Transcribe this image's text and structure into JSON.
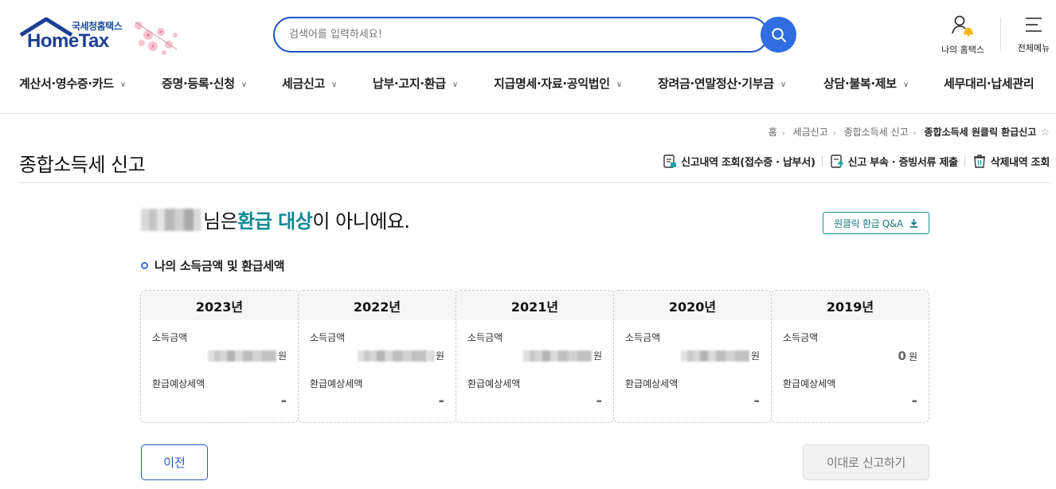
{
  "header": {
    "logo_small": "국세청홈택스",
    "logo_big": "HomeTax",
    "search_placeholder": "검색어를 입력하세요!",
    "my_hometax": "나의 홈택스",
    "all_menu": "전체메뉴"
  },
  "nav": {
    "items": [
      {
        "label": "계산서·영수증·카드"
      },
      {
        "label": "증명·등록·신청"
      },
      {
        "label": "세금신고"
      },
      {
        "label": "납부·고지·환급"
      },
      {
        "label": "지급명세·자료·공익법인"
      },
      {
        "label": "장려금·연말정산·기부금"
      },
      {
        "label": "상담·불복·제보"
      },
      {
        "label": "세무대리·납세관리"
      }
    ]
  },
  "breadcrumb": {
    "items": [
      "홈",
      "세금신고",
      "종합소득세 신고",
      "종합소득세 원클릭 환급신고"
    ]
  },
  "page": {
    "title": "종합소득세 신고",
    "quick_links": [
      "신고내역 조회(접수증 · 납부서)",
      "신고 부속 · 증빙서류 제출",
      "삭제내역 조회"
    ]
  },
  "result": {
    "suffix_pre": "님은 ",
    "highlight": "환급 대상",
    "suffix_post": "이 아니에요.",
    "qa_button": "원클릭 환급 Q&A"
  },
  "section": {
    "title": "나의 소득금액 및 환급세액"
  },
  "cards": [
    {
      "year": "2023년",
      "income_label": "소득금액",
      "income_value": "",
      "unit": "원",
      "refund_label": "환급예상세액",
      "refund_value": "-"
    },
    {
      "year": "2022년",
      "income_label": "소득금액",
      "income_value": "",
      "unit": "원",
      "refund_label": "환급예상세액",
      "refund_value": "-"
    },
    {
      "year": "2021년",
      "income_label": "소득금액",
      "income_value": "",
      "unit": "원",
      "refund_label": "환급예상세액",
      "refund_value": "-"
    },
    {
      "year": "2020년",
      "income_label": "소득금액",
      "income_value": "",
      "unit": "원",
      "refund_label": "환급예상세액",
      "refund_value": "-"
    },
    {
      "year": "2019년",
      "income_label": "소득금액",
      "income_value": "0",
      "unit": "원",
      "refund_label": "환급예상세액",
      "refund_value": "-"
    }
  ],
  "buttons": {
    "prev": "이전",
    "submit": "이대로 신고하기"
  },
  "colors": {
    "brand_blue": "#1b56c7",
    "highlight_teal": "#0e8a95"
  }
}
